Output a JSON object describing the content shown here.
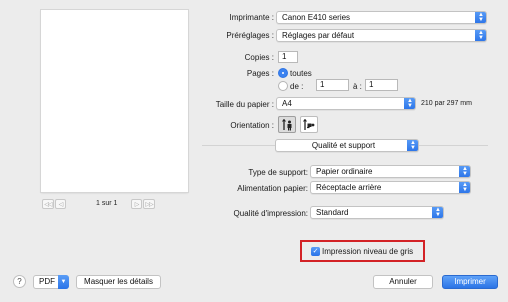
{
  "preview": {
    "page_counter": "1 sur 1",
    "nav_first": "◁◁",
    "nav_prev": "◁",
    "nav_next": "▷",
    "nav_last": "▷▷"
  },
  "printer": {
    "label": "Imprimante :",
    "value": "Canon E410 series"
  },
  "presets": {
    "label": "Préréglages :",
    "value": "Réglages par défaut"
  },
  "copies": {
    "label": "Copies :",
    "value": "1"
  },
  "pages": {
    "label": "Pages :",
    "all_label": "toutes",
    "from_label": "de :",
    "from_value": "1",
    "to_label": "à :",
    "to_value": "1"
  },
  "paper_size": {
    "label": "Taille du papier :",
    "value": "A4",
    "dimensions": "210 par 297 mm"
  },
  "orientation": {
    "label": "Orientation :"
  },
  "section": {
    "value": "Qualité et support"
  },
  "media_type": {
    "label": "Type de support:",
    "value": "Papier ordinaire"
  },
  "paper_source": {
    "label": "Alimentation papier:",
    "value": "Réceptacle arrière"
  },
  "print_quality": {
    "label": "Qualité d'impression:",
    "value": "Standard"
  },
  "grayscale": {
    "label": "Impression niveau de gris",
    "checked": true
  },
  "footer": {
    "help": "?",
    "pdf": "PDF",
    "hide_details": "Masquer les détails",
    "cancel": "Annuler",
    "print": "Imprimer"
  },
  "colors": {
    "accent": "#3b82f0",
    "highlight": "#d32226"
  },
  "icons": [
    "chevron-updown-icon",
    "portrait-icon",
    "landscape-icon",
    "checkmark-icon",
    "help-icon"
  ]
}
